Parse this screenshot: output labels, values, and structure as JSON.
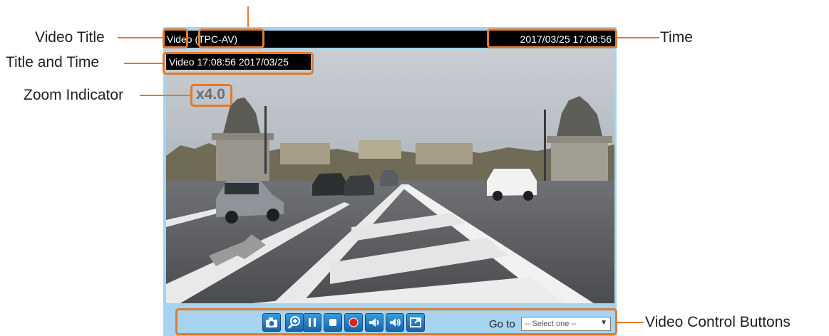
{
  "annotations": {
    "video_title": "Video Title",
    "title_and_time": "Title and Time",
    "zoom_indicator": "Zoom Indicator",
    "time": "Time",
    "video_control_buttons": "Video Control Buttons"
  },
  "player": {
    "title_name": "Video",
    "title_protocol": "(TPC-AV)",
    "time": "2017/03/25  17:08:56",
    "overlay_title_time": "Video 17:08:56  2017/03/25",
    "zoom": "x4.0",
    "goto_label": "Go to",
    "select_value": "-- Select one --"
  },
  "controls": [
    {
      "name": "snapshot-icon"
    },
    {
      "name": "digital-zoom-icon"
    },
    {
      "name": "pause-icon"
    },
    {
      "name": "stop-icon"
    },
    {
      "name": "record-icon"
    },
    {
      "name": "volume-icon"
    },
    {
      "name": "talk-icon"
    },
    {
      "name": "fullscreen-icon"
    }
  ],
  "colors": {
    "callout": "#e07a2f",
    "panel": "#a7d3ee",
    "button": "#1f70b8"
  }
}
